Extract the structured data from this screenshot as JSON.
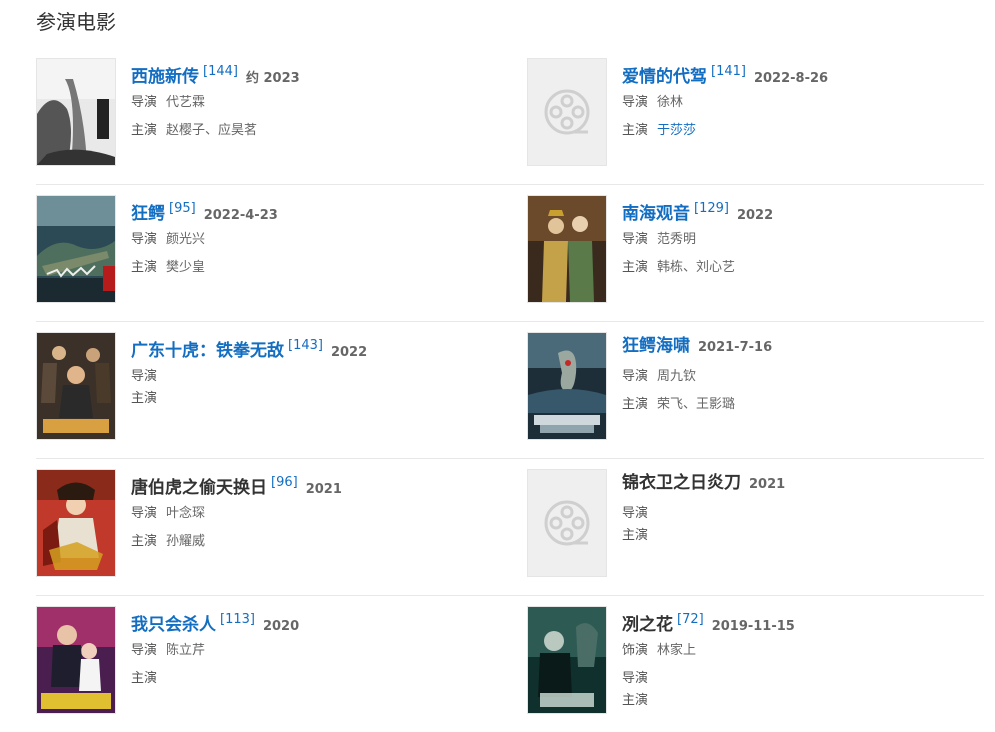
{
  "section_title": "参演电影",
  "films": [
    {
      "title": "西施新传",
      "ref": "[144]",
      "date": "约 2023",
      "linked": true,
      "placeholder": false,
      "rows": [
        {
          "label": "导演",
          "value": "代艺霖",
          "link": false
        },
        {
          "label": "主演",
          "value": "赵樱子、应昊茗",
          "link": false
        }
      ]
    },
    {
      "title": "爱情的代驾",
      "ref": "[141]",
      "date": "2022-8-26",
      "linked": true,
      "placeholder": true,
      "rows": [
        {
          "label": "导演",
          "value": "徐林",
          "link": false
        },
        {
          "label": "主演",
          "value": "于莎莎",
          "link": true
        }
      ]
    },
    {
      "title": "狂鳄",
      "ref": "[95]",
      "date": "2022-4-23",
      "linked": true,
      "placeholder": false,
      "rows": [
        {
          "label": "导演",
          "value": "颜光兴",
          "link": false
        },
        {
          "label": "主演",
          "value": "樊少皇",
          "link": false
        }
      ]
    },
    {
      "title": "南海观音",
      "ref": "[129]",
      "date": "2022",
      "linked": true,
      "placeholder": false,
      "rows": [
        {
          "label": "导演",
          "value": "范秀明",
          "link": false
        },
        {
          "label": "主演",
          "value": "韩栋、刘心艺",
          "link": false
        }
      ]
    },
    {
      "title": "广东十虎：铁拳无敌",
      "ref": "[143]",
      "date": "2022",
      "linked": true,
      "placeholder": false,
      "rows": [
        {
          "label": "导演",
          "value": "",
          "link": false
        },
        {
          "label": "主演",
          "value": "",
          "link": false
        }
      ]
    },
    {
      "title": "狂鳄海啸",
      "ref": "",
      "date": "2021-7-16",
      "linked": true,
      "placeholder": false,
      "rows": [
        {
          "label": "导演",
          "value": "周九钦",
          "link": false
        },
        {
          "label": "主演",
          "value": "荣飞、王影璐",
          "link": false
        }
      ]
    },
    {
      "title": "唐伯虎之偷天换日",
      "ref": "[96]",
      "date": "2021",
      "linked": false,
      "placeholder": false,
      "rows": [
        {
          "label": "导演",
          "value": "叶念琛",
          "link": false
        },
        {
          "label": "主演",
          "value": "孙耀威",
          "link": false
        }
      ]
    },
    {
      "title": "锦衣卫之日炎刀",
      "ref": "",
      "date": "2021",
      "linked": false,
      "placeholder": true,
      "rows": [
        {
          "label": "导演",
          "value": "",
          "link": false
        },
        {
          "label": "主演",
          "value": "",
          "link": false
        }
      ]
    },
    {
      "title": "我只会杀人",
      "ref": "[113]",
      "date": "2020",
      "linked": true,
      "placeholder": false,
      "rows": [
        {
          "label": "导演",
          "value": "陈立芹",
          "link": false
        },
        {
          "label": "主演",
          "value": "",
          "link": false
        }
      ]
    },
    {
      "title": "冽之花",
      "ref": "[72]",
      "date": "2019-11-15",
      "linked": false,
      "placeholder": false,
      "rows": [
        {
          "label": "饰演",
          "value": "林家上",
          "link": false
        },
        {
          "label": "导演",
          "value": "",
          "link": false
        },
        {
          "label": "主演",
          "value": "",
          "link": false
        }
      ]
    }
  ],
  "colors": {
    "link": "#136ec2",
    "text": "#333333",
    "meta": "#666666",
    "divider": "#e8e8e8",
    "placeholder_bg": "#efefef"
  },
  "icons": {
    "placeholder": "film-reel-icon"
  }
}
